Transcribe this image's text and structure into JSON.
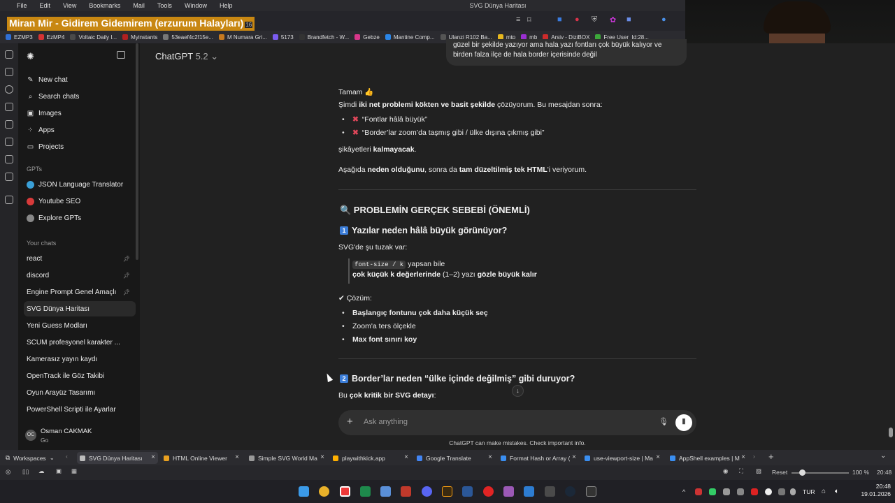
{
  "menubar": {
    "items": [
      "File",
      "Edit",
      "View",
      "Bookmarks",
      "Mail",
      "Tools",
      "Window",
      "Help"
    ],
    "window_title": "SVG Dünya Haritası"
  },
  "overlay": {
    "music_banner": "Miran Mir - Gidirem Gidemirem (erzurum Halayları)",
    "banner_suffix": "16"
  },
  "bookmarks": [
    {
      "label": "EZMP3",
      "color": "#2f6fd6"
    },
    {
      "label": "EzMP4",
      "color": "#d63333"
    },
    {
      "label": "Voltaic Daily I...",
      "color": "#4a4a4a"
    },
    {
      "label": "Myinstants",
      "color": "#b02020"
    },
    {
      "label": "53eaef4c2f15e...",
      "color": "#777"
    },
    {
      "label": "M Numara Gri...",
      "color": "#c77a1f"
    },
    {
      "label": "5173",
      "color": "#7b5cf0"
    },
    {
      "label": "Brandfetch - W...",
      "color": "#333"
    },
    {
      "label": "Gebze",
      "color": "#d8368a"
    },
    {
      "label": "Mantine Comp...",
      "color": "#2a86e8"
    },
    {
      "label": "Ulanzi R102 Ba...",
      "color": "#555"
    },
    {
      "label": "mtp",
      "color": "#e6b71e"
    },
    {
      "label": "mb",
      "color": "#9a2fd1"
    },
    {
      "label": "Arşiv - DiziBOX",
      "color": "#cc2b2b"
    },
    {
      "label": "Free User_Id:28...",
      "color": "#3ca83a"
    }
  ],
  "sidebar": {
    "top_items": [
      {
        "label": "New chat",
        "icon": "pencil-icon",
        "glyph": "✎"
      },
      {
        "label": "Search chats",
        "icon": "search-icon",
        "glyph": "⌕"
      },
      {
        "label": "Images",
        "icon": "image-icon",
        "glyph": "▣"
      },
      {
        "label": "Apps",
        "icon": "apps-icon",
        "glyph": "⁘"
      },
      {
        "label": "Projects",
        "icon": "folder-icon",
        "glyph": "▭"
      }
    ],
    "gpts_heading": "GPTs",
    "gpts": [
      {
        "label": "JSON Language Translator",
        "color": "#3aa0d8"
      },
      {
        "label": "Youtube SEO",
        "color": "#d83a3a"
      },
      {
        "label": "Explore GPTs",
        "color": "#888"
      }
    ],
    "chats_heading": "Your chats",
    "chats": [
      {
        "label": "react",
        "pinned": true
      },
      {
        "label": "discord",
        "pinned": true
      },
      {
        "label": "Engine Prompt Genel Amaçlı",
        "pinned": true
      },
      {
        "label": "SVG Dünya Haritası",
        "pinned": false,
        "active": true
      },
      {
        "label": "Yeni Guess Modları",
        "pinned": false
      },
      {
        "label": "SCUM profesyonel karakter ...",
        "pinned": false
      },
      {
        "label": "Kamerasız yayın kaydı",
        "pinned": false
      },
      {
        "label": "OpenTrack ile Göz Takibi",
        "pinned": false
      },
      {
        "label": "Oyun Arayüz Tasarımı",
        "pinned": false
      },
      {
        "label": "PowerShell Scripti ile Ayarlar",
        "pinned": false
      }
    ],
    "user": {
      "name": "Osman CAKMAK",
      "plan": "Go",
      "initials": "OC"
    }
  },
  "header": {
    "model": "ChatGPT",
    "version": "5.2"
  },
  "user_message": {
    "line1": "güzel bir şekilde yazıyor ama hala yazı fontları çok büyük kalıyor ve",
    "line2": "birden falza ilçe de hala border içerisinde değil"
  },
  "answer": {
    "p1": "Tamam 👍",
    "p2_a": "Şimdi ",
    "p2_b": "iki net problemi kökten ve basit şekilde",
    "p2_c": " çözüyorum. Bu mesajdan sonra:",
    "x1": "“Fontlar hâlâ büyük”",
    "x2": "“Border’lar zoom’da taşmış gibi / ülke dışına çıkmış gibi”",
    "p3_a": "şikâyetleri ",
    "p3_b": "kalmayacak",
    "p3_c": ".",
    "p4_a": "Aşağıda ",
    "p4_b": "neden olduğunu",
    "p4_c": ", sonra da ",
    "p4_d": "tam düzeltilmiş tek HTML",
    "p4_e": "'i veriyorum.",
    "h_main": "🔍 PROBLEMİN GERÇEK SEBEBİ (ÖNEMLİ)",
    "h1_num": "1",
    "h1": "Yazılar neden hâlâ büyük görünüyor?",
    "svg_note": "SVG'de şu tuzak var:",
    "quote_code": "font-size / k",
    "quote_a": " yapsan bile",
    "quote_b1": "çok küçük k değerlerinde",
    "quote_b2": " (1–2) yazı ",
    "quote_b3": "gözle büyük kalır",
    "solution": "✔ Çözüm:",
    "s1": "Başlangıç fontunu çok daha küçük seç",
    "s2": "Zoom'a ters ölçekle",
    "s3": "Max font sınırı koy",
    "h2_num": "2",
    "h2": "Border’lar neden “ülke içinde değilmiş” gibi duruyor?",
    "p5_a": "Bu ",
    "p5_b": "çok kritik bir SVG detayı",
    "p5_c": ":"
  },
  "composer": {
    "placeholder": "Ask anything",
    "disclaimer": "ChatGPT can make mistakes. Check important info."
  },
  "bottom_tabs": {
    "workspaces": "Workspaces",
    "tabs": [
      {
        "label": "SVG Dünya Haritası",
        "color": "#bbb",
        "active": true
      },
      {
        "label": "HTML Online Viewer",
        "color": "#e8a020"
      },
      {
        "label": "Simple SVG World Ma",
        "color": "#999"
      },
      {
        "label": "playwithkick.app",
        "color": "#ffb000"
      },
      {
        "label": "Google Translate",
        "color": "#4285f4"
      },
      {
        "label": "Format Hash or Array (",
        "color": "#3a8ef0"
      },
      {
        "label": "use-viewport-size | Ma",
        "color": "#3a8ef0"
      },
      {
        "label": "AppShell examples | M",
        "color": "#3a8ef0"
      }
    ]
  },
  "statusbar": {
    "reset": "Reset",
    "zoom": "100 %",
    "time": "20:48"
  },
  "taskbar": {
    "lang": "TUR",
    "time": "20:48",
    "date": "19.01.2026"
  }
}
